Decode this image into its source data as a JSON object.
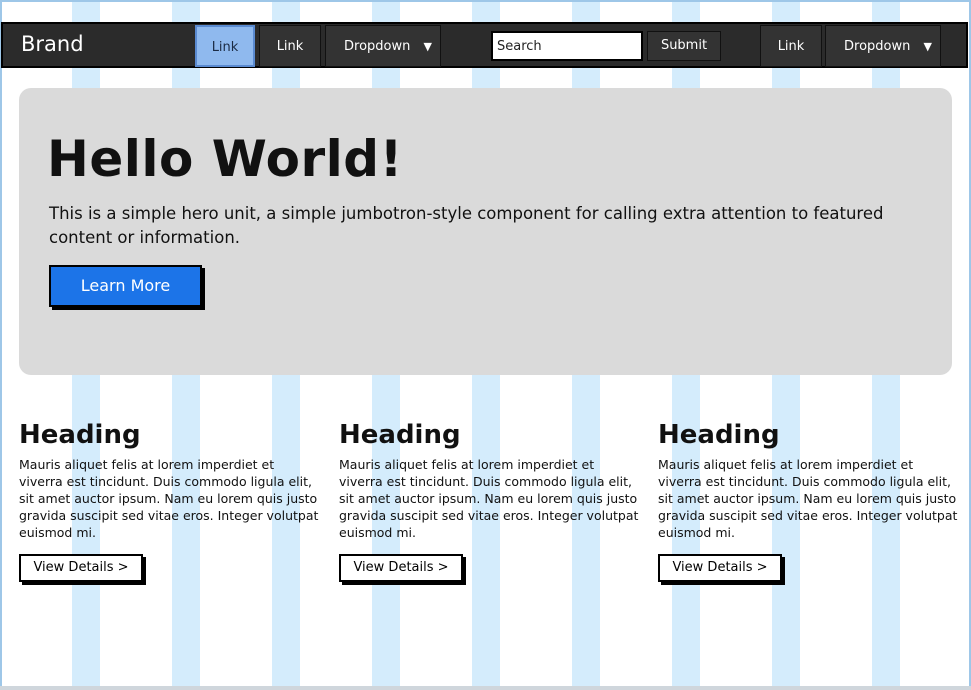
{
  "navbar": {
    "brand": "Brand",
    "items_left": [
      {
        "label": "Link",
        "active": true
      },
      {
        "label": "Link",
        "active": false
      },
      {
        "label": "Dropdown",
        "caret": "▼"
      }
    ],
    "search": {
      "value": "Search",
      "submit_label": "Submit"
    },
    "items_right": [
      {
        "label": "Link"
      },
      {
        "label": "Dropdown",
        "caret": "▼"
      }
    ]
  },
  "hero": {
    "title": "Hello World!",
    "text": "This is a simple hero unit, a simple jumbotron-style component for calling extra attention to featured content or information.",
    "button_label": "Learn More"
  },
  "columns": [
    {
      "heading": "Heading",
      "text": "Mauris aliquet felis at lorem imperdiet et viverra est tincidunt. Duis commodo ligula elit, sit amet auctor ipsum. Nam eu lorem quis justo gravida suscipit sed vitae eros. Integer volutpat euismod mi.",
      "button_label": "View Details >"
    },
    {
      "heading": "Heading",
      "text": "Mauris aliquet felis at lorem imperdiet et viverra est tincidunt. Duis commodo ligula elit, sit amet auctor ipsum. Nam eu lorem quis justo gravida suscipit sed vitae eros. Integer volutpat euismod mi.",
      "button_label": "View Details >"
    },
    {
      "heading": "Heading",
      "text": "Mauris aliquet felis at lorem imperdiet et viverra est tincidunt. Duis commodo ligula elit, sit amet auctor ipsum. Nam eu lorem quis justo gravida suscipit sed vitae eros. Integer volutpat euismod mi.",
      "button_label": "View Details >"
    }
  ],
  "colors": {
    "navbar_bg": "#2b2b2b",
    "active_link_bg": "#8fb9ee",
    "hero_bg": "#dadada",
    "primary_button": "#1c74e8",
    "grid_stripe": "#d4ecfc"
  }
}
